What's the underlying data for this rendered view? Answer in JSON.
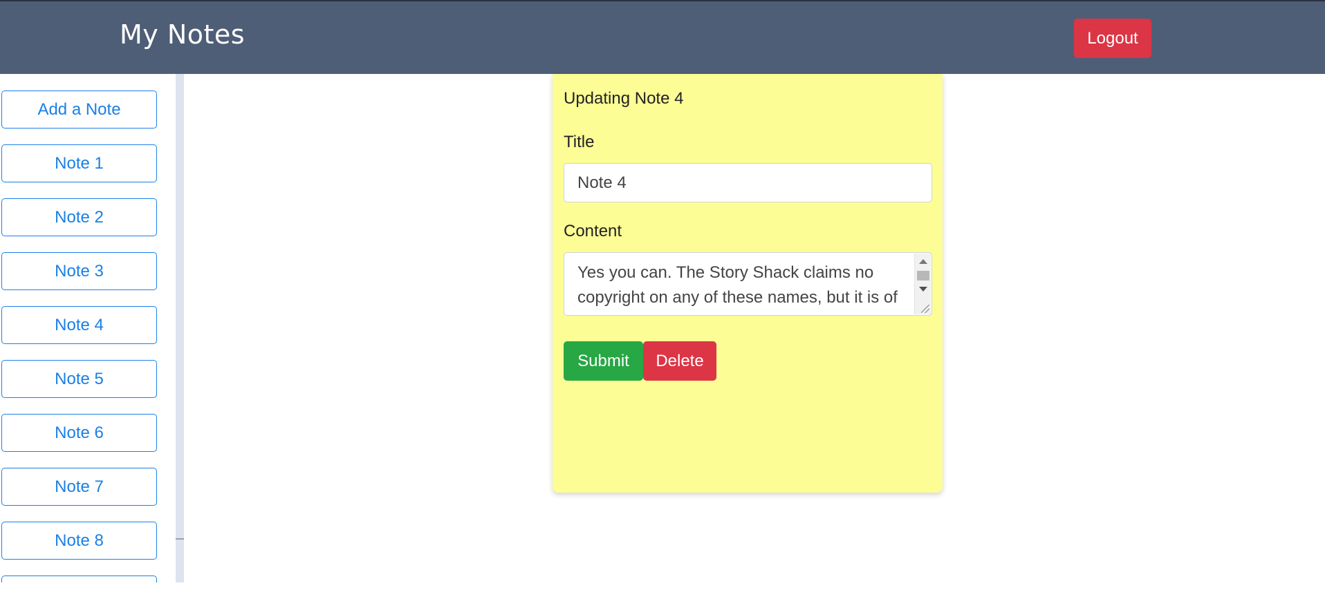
{
  "navbar": {
    "brand": "My Notes",
    "logout_label": "Logout"
  },
  "sidebar": {
    "items": [
      {
        "label": "Add a Note"
      },
      {
        "label": "Note 1"
      },
      {
        "label": "Note 2"
      },
      {
        "label": "Note 3"
      },
      {
        "label": "Note 4"
      },
      {
        "label": "Note 5"
      },
      {
        "label": "Note 6"
      },
      {
        "label": "Note 7"
      },
      {
        "label": "Note 8"
      },
      {
        "label": ""
      }
    ]
  },
  "editor": {
    "heading": "Updating Note 4",
    "title_label": "Title",
    "title_value": "Note 4",
    "content_label": "Content",
    "content_value": "Yes you can. The Story Shack claims no copyright on any of these names, but it is of",
    "submit_label": "Submit",
    "delete_label": "Delete"
  },
  "colors": {
    "navbar_bg": "#4f5e77",
    "panel_bg": "#fdfd96",
    "primary": "#1a7fe6",
    "danger": "#dc3545",
    "success": "#28a745"
  }
}
